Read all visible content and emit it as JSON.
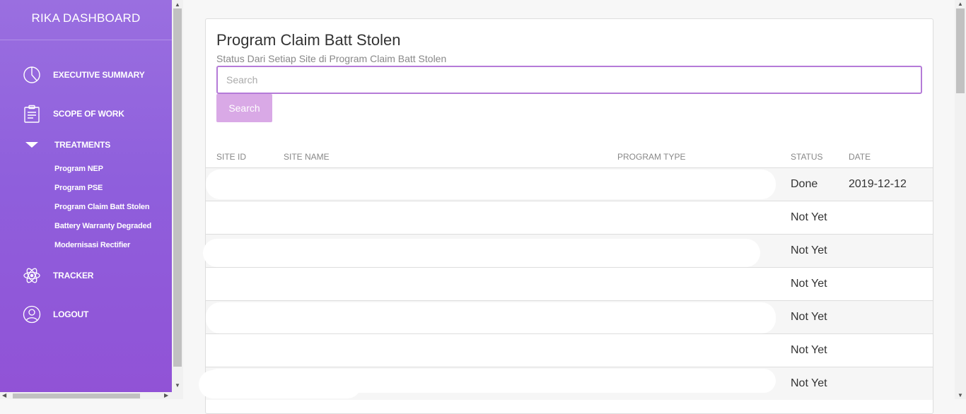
{
  "sidebar": {
    "brand": "RIKA DASHBOARD",
    "items": [
      {
        "label": "EXECUTIVE SUMMARY",
        "icon": "pie-chart-icon"
      },
      {
        "label": "SCOPE OF WORK",
        "icon": "clipboard-icon"
      },
      {
        "label": "TREATMENTS",
        "icon": "caret-down-icon"
      },
      {
        "label": "TRACKER",
        "icon": "atom-icon"
      },
      {
        "label": "LOGOUT",
        "icon": "user-icon"
      }
    ],
    "subitems": [
      {
        "label": "Program NEP"
      },
      {
        "label": "Program PSE"
      },
      {
        "label": "Program Claim Batt Stolen"
      },
      {
        "label": "Battery Warranty Degraded"
      },
      {
        "label": "Modernisasi Rectifier"
      }
    ]
  },
  "main": {
    "title": "Program Claim Batt Stolen",
    "subtitle": "Status Dari Setiap Site di Program Claim Batt Stolen",
    "search": {
      "placeholder": "Search",
      "value": "",
      "button_label": "Search"
    },
    "table": {
      "headers": [
        "SITE ID",
        "SITE NAME",
        "PROGRAM TYPE",
        "STATUS",
        "DATE"
      ],
      "rows": [
        {
          "status": "Done",
          "date": "2019-12-12"
        },
        {
          "status": "Not Yet",
          "date": ""
        },
        {
          "status": "Not Yet",
          "date": ""
        },
        {
          "status": "Not Yet",
          "date": ""
        },
        {
          "status": "Not Yet",
          "date": ""
        },
        {
          "status": "Not Yet",
          "date": ""
        },
        {
          "status": "Not Yet",
          "date": ""
        }
      ]
    }
  },
  "colors": {
    "sidebar": "#9a6fe0",
    "accent": "#b57bd8",
    "button": "#d9a9e6"
  }
}
